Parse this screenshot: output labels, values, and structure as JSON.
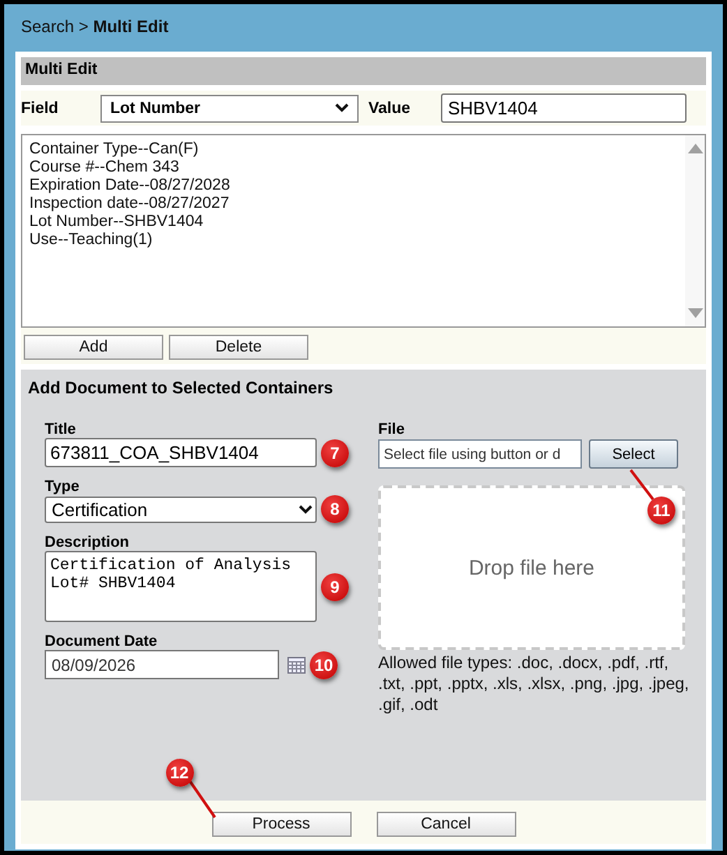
{
  "breadcrumb": "Search > **Multi Edit**",
  "multi_edit": {
    "title": "Multi Edit",
    "field_label": "Field",
    "field_value": "Lot Number",
    "value_label": "Value",
    "value": "SHBV1404",
    "list_items": [
      "Container Type--Can(F)",
      "Course #--Chem 343",
      "Expiration Date--08/27/2028",
      "Inspection date--08/27/2027",
      "Lot Number--SHBV1404",
      "Use--Teaching(1)"
    ],
    "buttons": [
      "Add",
      "Delete"
    ]
  },
  "document": {
    "title": "Add Document to Selected Containers",
    "fields": [
      {
        "kind": "text",
        "label": "Title",
        "value": "673811_COA_SHBV1404",
        "callout": "7"
      },
      {
        "kind": "select",
        "label": "Type",
        "value": "Certification",
        "callout": "8"
      },
      {
        "kind": "textarea",
        "label": "Description",
        "value": "Certification of Analysis\nLot# SHBV1404",
        "callout": "9"
      },
      {
        "kind": "date",
        "label": "Document Date",
        "value": "08/09/2026",
        "callout": "10"
      }
    ],
    "file": {
      "label": "File",
      "placeholder": "Select file using button or d",
      "button": "Select",
      "callout": "11",
      "drop_text": "Drop file here",
      "allowed": "Allowed file types: .doc, .docx, .pdf, .rtf, .txt, .ppt, .pptx, .xls, .xlsx, .png, .jpg, .jpeg, .gif, .odt"
    }
  },
  "actions": [
    {
      "label": "Process",
      "callout": "12"
    },
    {
      "label": "Cancel"
    }
  ]
}
